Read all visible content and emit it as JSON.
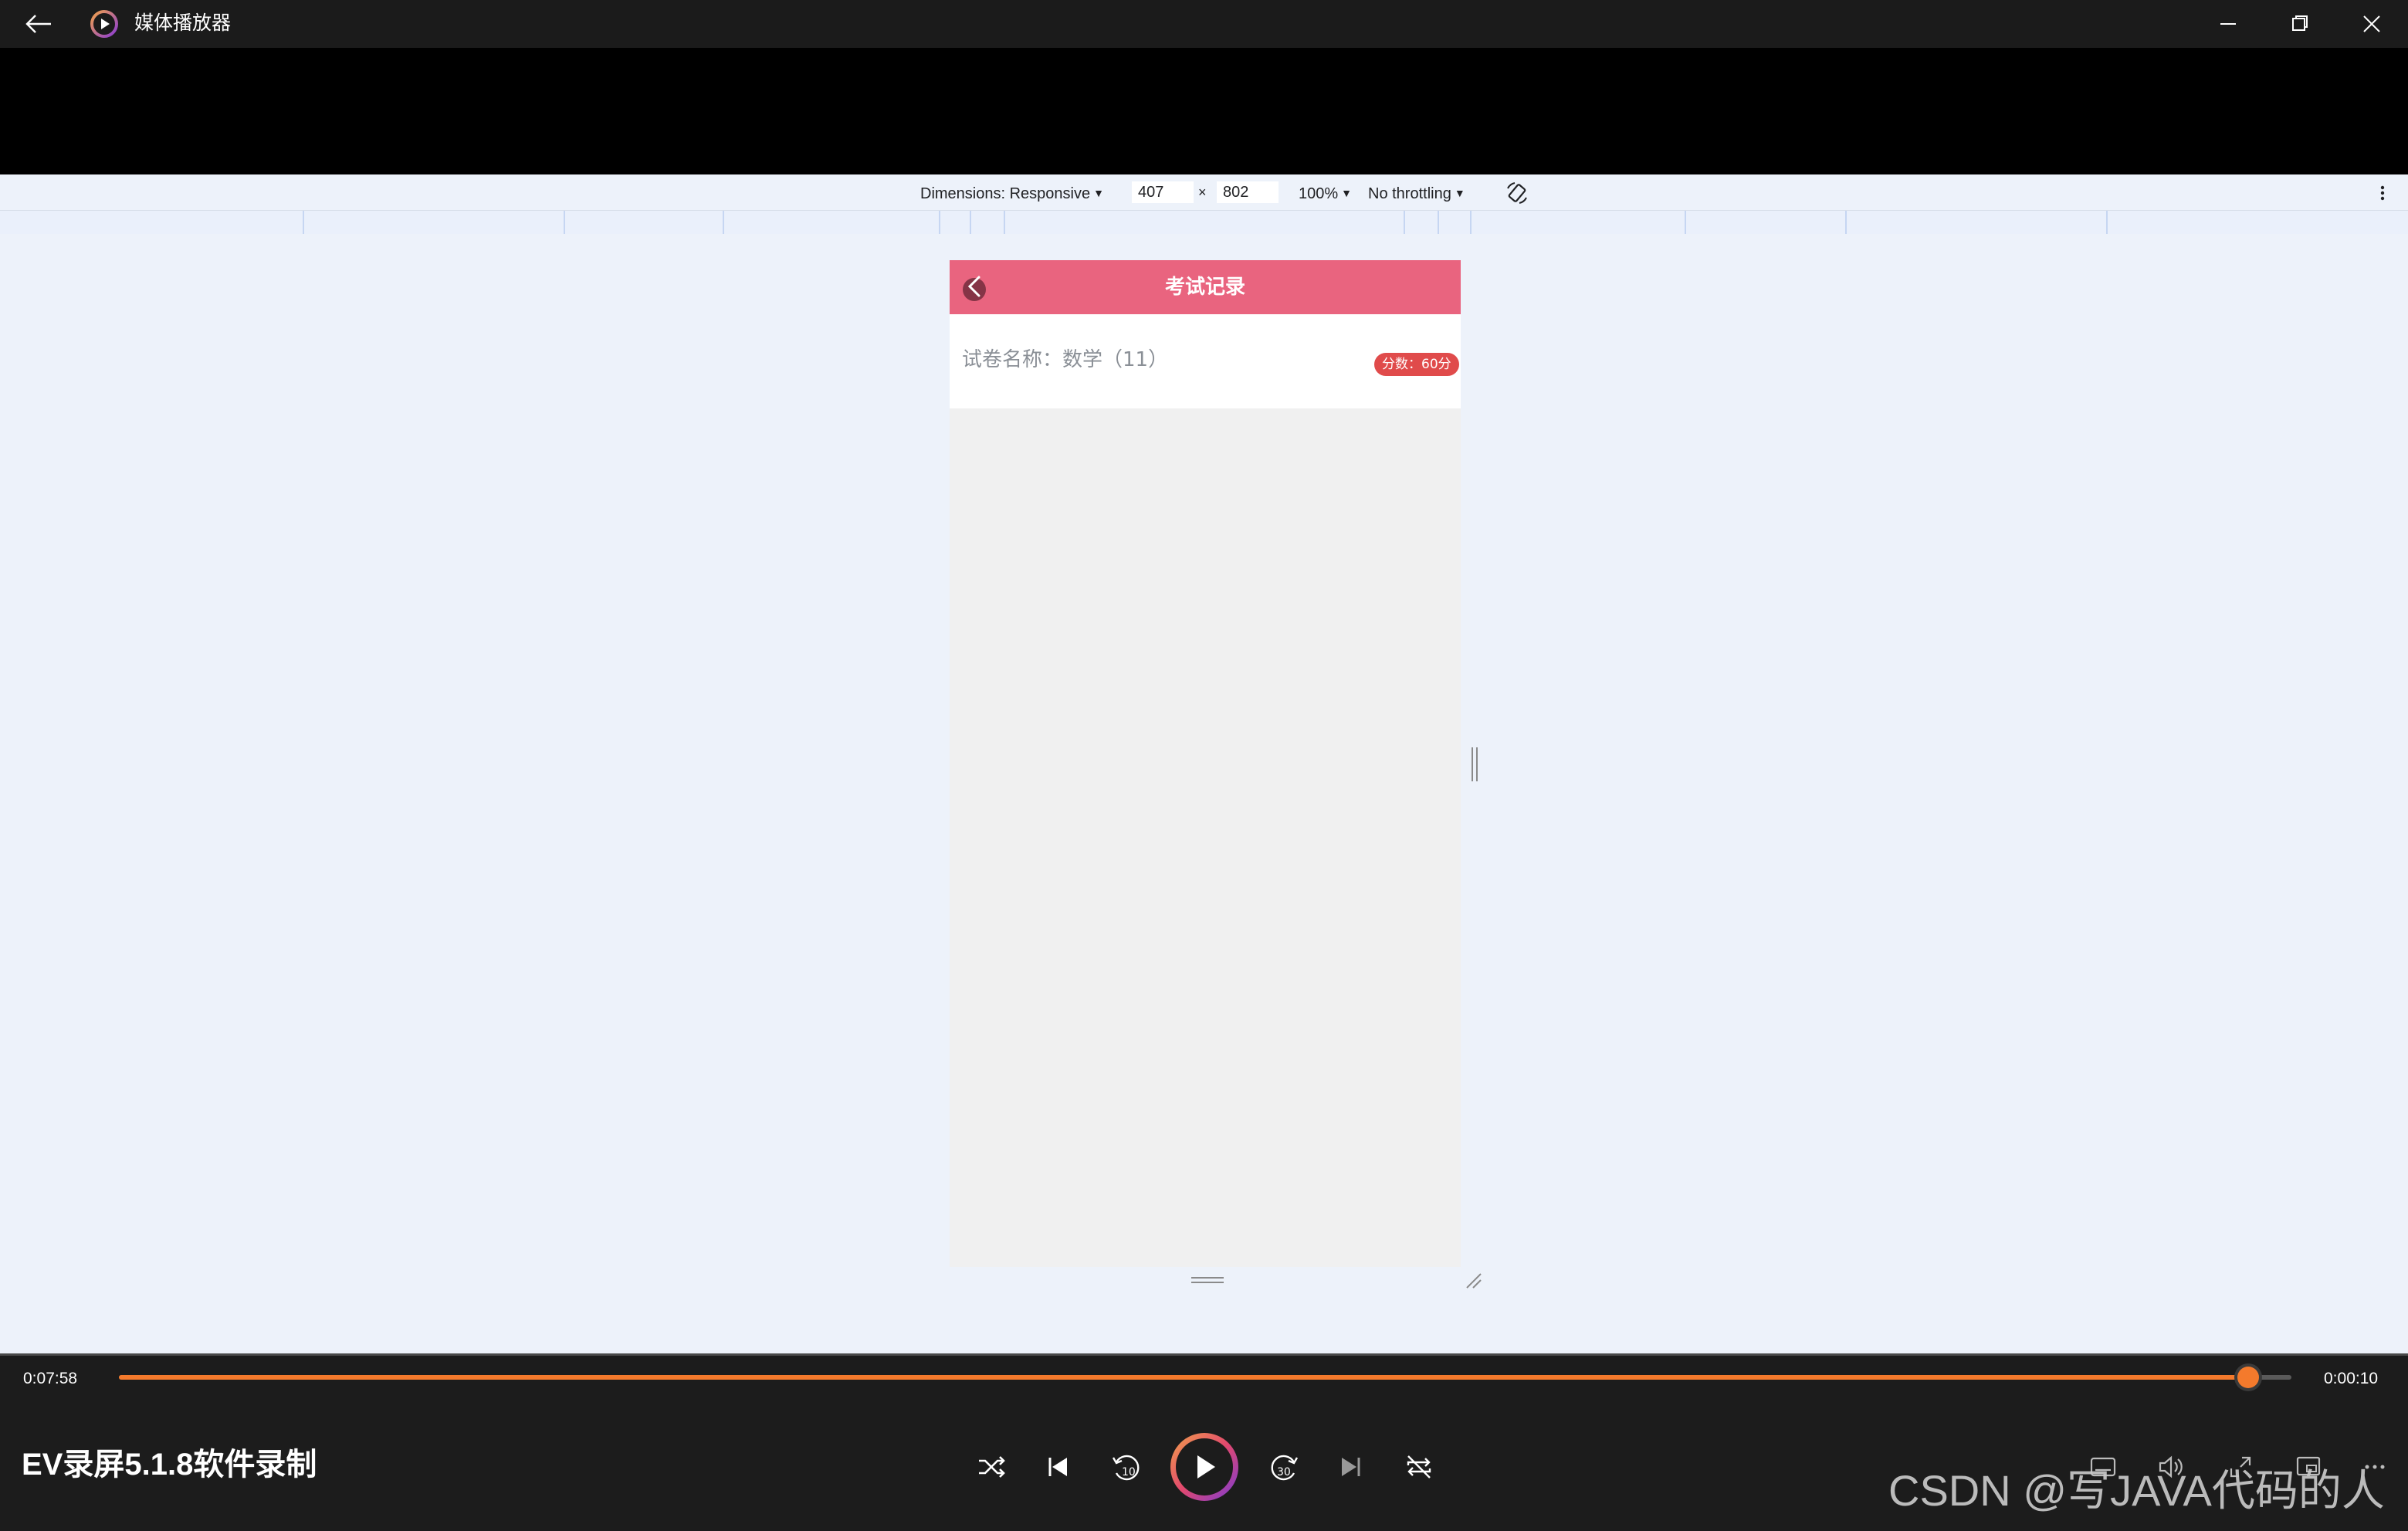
{
  "window": {
    "title": "媒体播放器"
  },
  "devtools": {
    "dimensions_label": "Dimensions: Responsive",
    "width_value": "407",
    "times_symbol": "×",
    "height_value": "802",
    "zoom": "100%",
    "throttling": "No throttling"
  },
  "app": {
    "header_title": "考试记录",
    "header_color": "#e9647f",
    "records": [
      {
        "label": "试卷名称：数学（11）",
        "score_badge": "分数：60分"
      }
    ]
  },
  "player": {
    "current_time": "0:07:58",
    "end_time": "0:00:10",
    "progress_fraction": 0.98,
    "accent_color": "#f47a2c",
    "recording_note": "EV录屏5.1.8软件录制",
    "controls": [
      "shuffle-icon",
      "previous-icon",
      "rewind-10-icon",
      "play-icon",
      "forward-30-icon",
      "next-icon",
      "repeat-off-icon"
    ],
    "right_controls": [
      "subtitles-icon",
      "volume-icon",
      "fullscreen-icon",
      "mini-player-icon",
      "more-icon"
    ]
  },
  "watermark": "CSDN @写JAVA代码的人"
}
